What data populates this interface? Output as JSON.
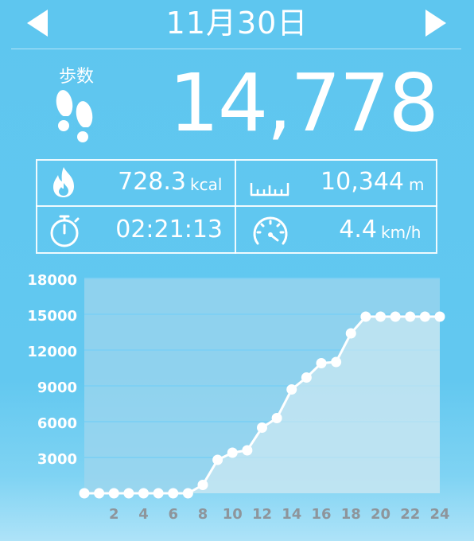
{
  "header": {
    "date": "11月30日"
  },
  "steps": {
    "label": "歩数",
    "value": "14,778"
  },
  "stats": {
    "calories": {
      "value": "728.3",
      "unit": "kcal",
      "icon": "flame-icon"
    },
    "distance": {
      "value": "10,344",
      "unit": "m",
      "icon": "ruler-icon"
    },
    "time": {
      "value": "02:21:13",
      "unit": "",
      "icon": "stopwatch-icon"
    },
    "speed": {
      "value": "4.4",
      "unit": "km/h",
      "icon": "speedometer-icon"
    }
  },
  "colors": {
    "background": "#5ec6ef",
    "foreground": "#ffffff",
    "plot_area": "#9fd6ee"
  },
  "chart_data": {
    "type": "line",
    "title": "",
    "xlabel": "",
    "ylabel": "",
    "x": [
      0,
      1,
      2,
      3,
      4,
      5,
      6,
      7,
      8,
      9,
      10,
      11,
      12,
      13,
      14,
      15,
      16,
      17,
      18,
      19,
      20,
      21,
      22,
      23,
      24
    ],
    "series": [
      {
        "values": [
          0,
          0,
          0,
          0,
          0,
          0,
          0,
          0,
          700,
          2800,
          3400,
          3600,
          5500,
          6300,
          8700,
          9700,
          10900,
          11000,
          13400,
          14800,
          14800,
          14800,
          14800,
          14800,
          14800
        ]
      }
    ],
    "xticks": [
      "2",
      "4",
      "6",
      "8",
      "10",
      "12",
      "14",
      "16",
      "18",
      "20",
      "22",
      "24"
    ],
    "yticks": [
      "3000",
      "6000",
      "9000",
      "12000",
      "15000",
      "18000"
    ],
    "xlim": [
      0,
      24
    ],
    "ylim": [
      0,
      18000
    ],
    "grid": true,
    "area_fill": true
  }
}
